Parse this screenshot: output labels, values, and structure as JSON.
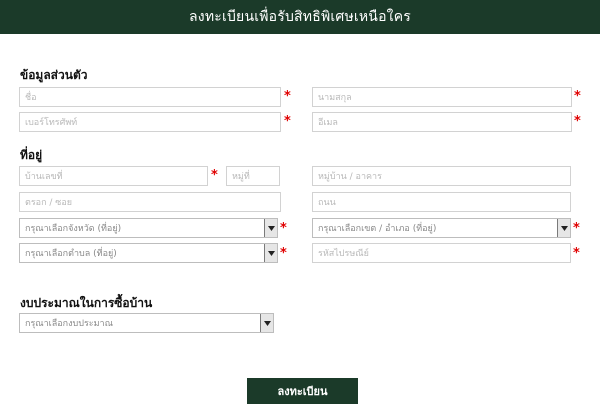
{
  "header": {
    "title": "ลงทะเบียนเพื่อรับสิทธิพิเศษเหนือใคร"
  },
  "personal": {
    "title": "ข้อมูลส่วนตัว",
    "first_name_placeholder": "ชื่อ",
    "last_name_placeholder": "นามสกุล",
    "phone_placeholder": "เบอร์โทรศัพท์",
    "email_placeholder": "อีเมล"
  },
  "address": {
    "title": "ที่อยู่",
    "house_no_placeholder": "บ้านเลขที่",
    "moo_placeholder": "หมู่ที่",
    "village_placeholder": "หมู่บ้าน / อาคาร",
    "soi_placeholder": "ตรอก / ซอย",
    "road_placeholder": "ถนน",
    "province_select": "กรุณาเลือกจังหวัด (ที่อยู่)",
    "district_select": "กรุณาเลือกเขต / อำเภอ (ที่อยู่)",
    "subdistrict_select": "กรุณาเลือกตำบล (ที่อยู่)",
    "postcode_placeholder": "รหัสไปรษณีย์"
  },
  "budget": {
    "title": "งบประมาณในการซื้อบ้าน",
    "budget_select": "กรุณาเลือกงบประมาณ"
  },
  "required_mark": "*",
  "submit_label": "ลงทะเบียน",
  "colors": {
    "brand": "#1b3a29",
    "required": "#e00000"
  }
}
